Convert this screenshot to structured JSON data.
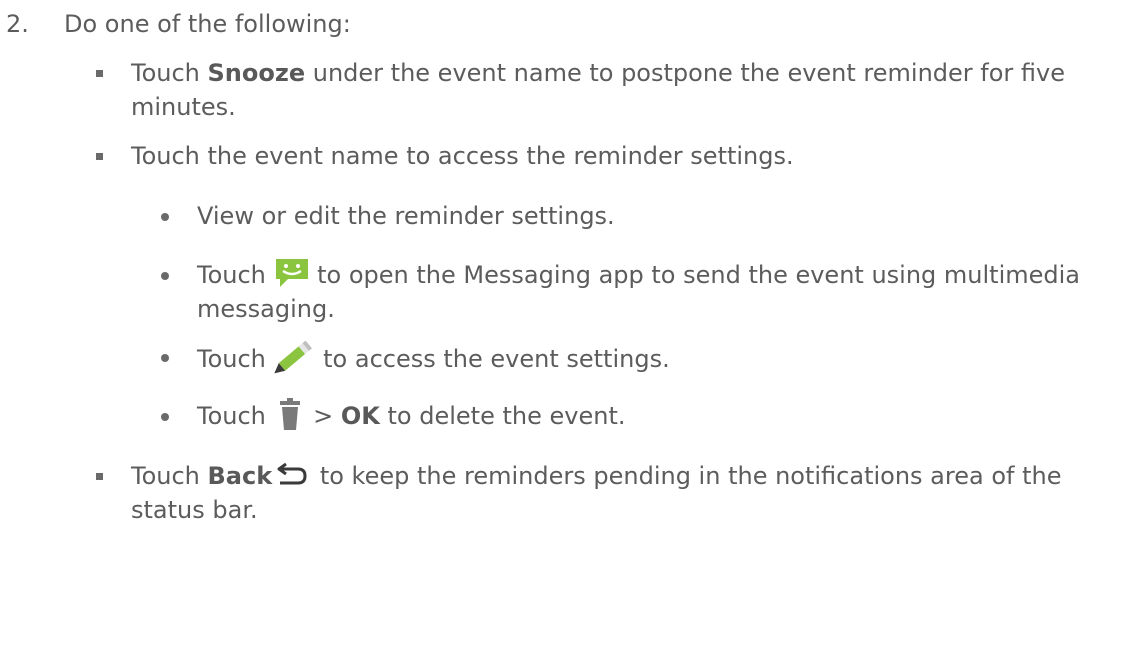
{
  "step": {
    "number": "2.",
    "title": "Do one of the following:"
  },
  "items": {
    "snooze": {
      "prefix": "Touch ",
      "bold": "Snooze",
      "suffix": " under the event name to postpone the event reminder for five",
      "line2": "minutes."
    },
    "event_name": {
      "text": "Touch the event name to access the reminder settings."
    },
    "sub": {
      "view_edit": "View or edit the reminder settings.",
      "messaging_prefix": "Touch ",
      "messaging_suffix": " to open the Messaging app to send the event using multimedia",
      "messaging_line2": "messaging.",
      "edit_prefix": "Touch ",
      "edit_suffix": " to access the event settings.",
      "delete_prefix": "Touch ",
      "delete_mid": " > ",
      "delete_bold": "OK",
      "delete_suffix": " to delete the event."
    },
    "back": {
      "prefix": "Touch ",
      "bold": "Back",
      "suffix": " to keep the reminders pending in the notifications area of the",
      "line2": "status bar."
    }
  },
  "icons": {
    "messaging": "messaging-icon",
    "edit": "pencil-icon",
    "delete": "trash-icon",
    "back": "back-arrow-icon"
  },
  "colors": {
    "text": "#5c5c5c",
    "messaging_icon": "#8bc53f",
    "pencil_icon": "#8bc53f",
    "trash_icon": "#7a7a7a"
  }
}
